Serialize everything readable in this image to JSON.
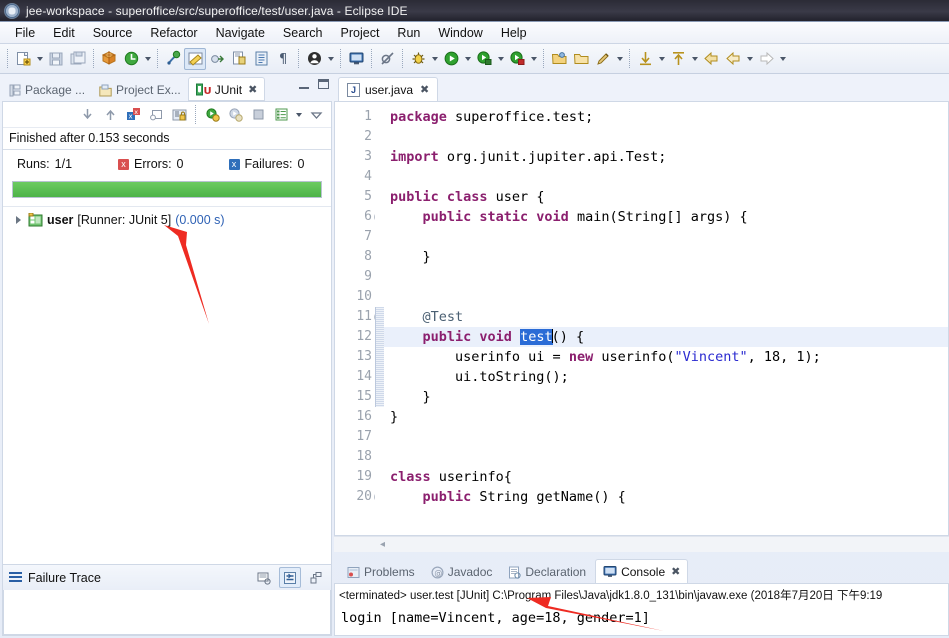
{
  "window": {
    "title": "jee-workspace - superoffice/src/superoffice/test/user.java - Eclipse IDE",
    "app_icon": "eclipse-icon"
  },
  "menubar": {
    "items": [
      {
        "label": "File"
      },
      {
        "label": "Edit"
      },
      {
        "label": "Source"
      },
      {
        "label": "Refactor"
      },
      {
        "label": "Navigate"
      },
      {
        "label": "Search"
      },
      {
        "label": "Project"
      },
      {
        "label": "Run"
      },
      {
        "label": "Window"
      },
      {
        "label": "Help"
      }
    ]
  },
  "toolbar": {
    "items": [
      {
        "name": "new-wizard-icon",
        "type": "button"
      },
      {
        "name": "new-wizard-dropdown-icon",
        "type": "caret"
      },
      {
        "name": "save-icon",
        "type": "button"
      },
      {
        "name": "save-all-icon",
        "type": "button"
      },
      {
        "name": "separator",
        "type": "sep"
      },
      {
        "name": "new-java-package-icon",
        "type": "button"
      },
      {
        "name": "refresh-icon",
        "type": "button"
      },
      {
        "name": "refresh-dropdown-icon",
        "type": "caret"
      },
      {
        "name": "separator",
        "type": "sep"
      },
      {
        "name": "quick-fix-icon",
        "type": "button"
      },
      {
        "name": "highlight-toggle-icon",
        "type": "button-pressed"
      },
      {
        "name": "open-task-icon",
        "type": "button"
      },
      {
        "name": "new-java-class-icon",
        "type": "button"
      },
      {
        "name": "open-type-icon",
        "type": "button"
      },
      {
        "name": "show-whitespace-icon",
        "type": "button"
      },
      {
        "name": "separator",
        "type": "sep"
      },
      {
        "name": "profile-icon",
        "type": "button"
      },
      {
        "name": "profile-dropdown-icon",
        "type": "caret"
      },
      {
        "name": "separator",
        "type": "sep"
      },
      {
        "name": "open-console-icon",
        "type": "button"
      },
      {
        "name": "separator",
        "type": "sep"
      },
      {
        "name": "skip-breakpoints-icon",
        "type": "button"
      },
      {
        "name": "separator",
        "type": "sep"
      },
      {
        "name": "debug-icon",
        "type": "button"
      },
      {
        "name": "debug-dropdown-icon",
        "type": "caret"
      },
      {
        "name": "run-icon",
        "type": "button"
      },
      {
        "name": "run-dropdown-icon",
        "type": "caret"
      },
      {
        "name": "run-as-server-icon",
        "type": "button"
      },
      {
        "name": "run-as-server-dropdown-icon",
        "type": "caret"
      },
      {
        "name": "coverage-icon",
        "type": "button"
      },
      {
        "name": "coverage-dropdown-icon",
        "type": "caret"
      },
      {
        "name": "separator",
        "type": "sep"
      },
      {
        "name": "open-folder-icon",
        "type": "button"
      },
      {
        "name": "open-folder-2-icon",
        "type": "button"
      },
      {
        "name": "pencil-icon",
        "type": "button"
      },
      {
        "name": "pencil-dropdown-icon",
        "type": "caret"
      },
      {
        "name": "separator",
        "type": "sep"
      },
      {
        "name": "next-annotation-icon",
        "type": "button"
      },
      {
        "name": "next-annotation-dropdown-icon",
        "type": "caret"
      },
      {
        "name": "previous-annotation-icon",
        "type": "button"
      },
      {
        "name": "previous-annotation-dropdown-icon",
        "type": "caret"
      },
      {
        "name": "back-history-icon",
        "type": "button"
      },
      {
        "name": "back-icon",
        "type": "button"
      },
      {
        "name": "back-dropdown-icon",
        "type": "caret"
      },
      {
        "name": "forward-icon",
        "type": "button"
      },
      {
        "name": "forward-dropdown-icon",
        "type": "caret"
      }
    ]
  },
  "left_view": {
    "tabs": [
      {
        "label": "Package ...",
        "icon": "package-explorer-icon",
        "active": false
      },
      {
        "label": "Project Ex...",
        "icon": "project-explorer-icon",
        "active": false
      },
      {
        "label": "JUnit",
        "icon": "junit-icon",
        "active": true,
        "close": "✖"
      }
    ],
    "view_buttons": [
      {
        "name": "minimize-view-icon"
      },
      {
        "name": "maximize-view-icon"
      }
    ],
    "junit_toolbar": [
      {
        "name": "next-failed-test-icon"
      },
      {
        "name": "previous-failed-test-icon"
      },
      {
        "name": "show-failures-only-icon"
      },
      {
        "name": "show-ignored-tests-icon"
      },
      {
        "name": "scroll-lock-icon"
      },
      {
        "name": "rerun-test-icon"
      },
      {
        "name": "rerun-failed-tests-icon"
      },
      {
        "name": "stop-test-run-icon"
      },
      {
        "name": "test-run-history-icon"
      },
      {
        "name": "view-menu-dropdown-icon"
      },
      {
        "name": "view-menu-icon"
      }
    ],
    "status_text": "Finished after 0.153 seconds",
    "counters": {
      "runs_label": "Runs:",
      "runs_value": "1/1",
      "errors_label": "Errors:",
      "errors_value": "0",
      "failures_label": "Failures:",
      "failures_value": "0"
    },
    "progress": {
      "percent": 100,
      "color": "#4db348"
    },
    "tree": [
      {
        "name": "user",
        "runner": "[Runner: JUnit 5]",
        "time": "(0.000 s)",
        "icon": "test-suite-icon",
        "twisty": "collapsed"
      }
    ],
    "failure_trace": {
      "title": "Failure Trace",
      "icon": "failure-trace-icon",
      "buttons": [
        {
          "name": "compare-result-icon"
        },
        {
          "name": "filter-stack-trace-icon"
        },
        {
          "name": "view-menu-icon"
        }
      ],
      "content": ""
    }
  },
  "editor": {
    "tab": {
      "label": "user.java",
      "icon": "java-file-icon",
      "close": "✖"
    },
    "current_line": 12,
    "lines": [
      {
        "n": "1",
        "fold": false,
        "annot": false,
        "tokens": [
          {
            "t": "package",
            "c": "kw"
          },
          {
            "t": " superoffice.test;",
            "c": ""
          }
        ]
      },
      {
        "n": "2",
        "fold": false,
        "annot": false,
        "tokens": []
      },
      {
        "n": "3",
        "fold": false,
        "annot": false,
        "tokens": [
          {
            "t": "import",
            "c": "kw"
          },
          {
            "t": " org.junit.jupiter.api.Test;",
            "c": ""
          }
        ]
      },
      {
        "n": "4",
        "fold": false,
        "annot": false,
        "tokens": []
      },
      {
        "n": "5",
        "fold": false,
        "annot": false,
        "tokens": [
          {
            "t": "public class",
            "c": "kw"
          },
          {
            "t": " user {",
            "c": ""
          }
        ]
      },
      {
        "n": "6",
        "fold": true,
        "annot": false,
        "tokens": [
          {
            "t": "    ",
            "c": ""
          },
          {
            "t": "public static void",
            "c": "kw"
          },
          {
            "t": " main(String[] args) {",
            "c": ""
          }
        ]
      },
      {
        "n": "7",
        "fold": false,
        "annot": false,
        "tokens": []
      },
      {
        "n": "8",
        "fold": false,
        "annot": false,
        "tokens": [
          {
            "t": "    }",
            "c": ""
          }
        ]
      },
      {
        "n": "9",
        "fold": false,
        "annot": false,
        "tokens": []
      },
      {
        "n": "10",
        "fold": false,
        "annot": false,
        "tokens": []
      },
      {
        "n": "11",
        "fold": true,
        "annot": true,
        "tokens": [
          {
            "t": "    ",
            "c": ""
          },
          {
            "t": "@Test",
            "c": "ann"
          }
        ]
      },
      {
        "n": "12",
        "fold": false,
        "annot": true,
        "current": true,
        "tokens": [
          {
            "t": "    ",
            "c": ""
          },
          {
            "t": "public void",
            "c": "kw"
          },
          {
            "t": " ",
            "c": ""
          },
          {
            "t": "test",
            "c": "sel"
          },
          {
            "t": "CARET",
            "c": "caret"
          },
          {
            "t": "() {",
            "c": ""
          }
        ]
      },
      {
        "n": "13",
        "fold": false,
        "annot": true,
        "tokens": [
          {
            "t": "        userinfo ui = ",
            "c": ""
          },
          {
            "t": "new",
            "c": "kw"
          },
          {
            "t": " userinfo(",
            "c": ""
          },
          {
            "t": "\"Vincent\"",
            "c": "str"
          },
          {
            "t": ", 18, 1);",
            "c": ""
          }
        ]
      },
      {
        "n": "14",
        "fold": false,
        "annot": true,
        "tokens": [
          {
            "t": "        ui.toString();",
            "c": ""
          }
        ]
      },
      {
        "n": "15",
        "fold": false,
        "annot": true,
        "tokens": [
          {
            "t": "    }",
            "c": ""
          }
        ]
      },
      {
        "n": "16",
        "fold": false,
        "annot": false,
        "tokens": [
          {
            "t": "}",
            "c": ""
          }
        ]
      },
      {
        "n": "17",
        "fold": false,
        "annot": false,
        "tokens": []
      },
      {
        "n": "18",
        "fold": false,
        "annot": false,
        "tokens": []
      },
      {
        "n": "19",
        "fold": false,
        "annot": false,
        "tokens": [
          {
            "t": "class",
            "c": "kw"
          },
          {
            "t": " userinfo{",
            "c": ""
          }
        ]
      },
      {
        "n": "20",
        "fold": true,
        "annot": false,
        "tokens": [
          {
            "t": "    ",
            "c": ""
          },
          {
            "t": "public",
            "c": "kw"
          },
          {
            "t": " String getName() {",
            "c": ""
          }
        ]
      }
    ],
    "hscroll_marker": "◂"
  },
  "console": {
    "tabs": [
      {
        "label": "Problems",
        "icon": "problems-icon",
        "active": false
      },
      {
        "label": "Javadoc",
        "icon": "javadoc-icon",
        "active": false
      },
      {
        "label": "Declaration",
        "icon": "declaration-icon",
        "active": false
      },
      {
        "label": "Console",
        "icon": "console-icon",
        "active": true,
        "close": "✖"
      }
    ],
    "terminated_line": "<terminated> user.test [JUnit] C:\\Program Files\\Java\\jdk1.8.0_131\\bin\\javaw.exe (2018年7月20日 下午9:19",
    "output": "login [name=Vincent, age=18, gender=1]"
  },
  "annotations": {
    "arrows": [
      {
        "name": "arrow-to-junit-result",
        "color": "#ee2b22"
      },
      {
        "name": "arrow-to-console-output",
        "color": "#ee2b22"
      }
    ]
  }
}
